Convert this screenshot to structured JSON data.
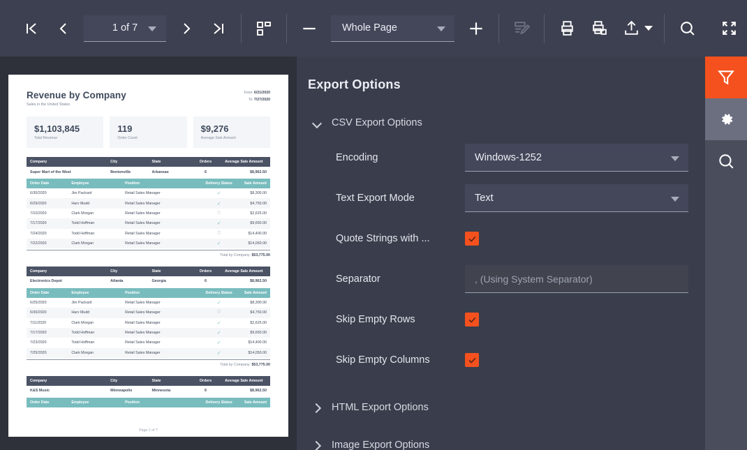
{
  "toolbar": {
    "first_page_label": "first-page",
    "prev_page_label": "previous-page",
    "page_indicator": "1 of 7",
    "next_page_label": "next-page",
    "last_page_label": "last-page",
    "page_layout_label": "page-layout",
    "zoom_out_label": "zoom-out",
    "zoom_level": "Whole Page",
    "zoom_in_label": "zoom-in",
    "edit_label": "edit-document",
    "print_label": "print",
    "print_copies_label": "print-multiple",
    "export_label": "export",
    "export_caret_label": "export-menu",
    "search_label": "search",
    "fullscreen_label": "fullscreen"
  },
  "export_panel": {
    "title": "Export Options",
    "sections": [
      {
        "label": "CSV Export Options",
        "expanded": true
      },
      {
        "label": "HTML Export Options",
        "expanded": false
      },
      {
        "label": "Image Export Options",
        "expanded": false
      }
    ],
    "csv_options": {
      "encoding": {
        "label": "Encoding",
        "value": "Windows-1252",
        "type": "select"
      },
      "text_export_mode": {
        "label": "Text Export Mode",
        "value": "Text",
        "type": "select"
      },
      "quote_strings": {
        "label": "Quote Strings with ...",
        "checked": true,
        "type": "checkbox"
      },
      "separator": {
        "label": "Separator",
        "value": "",
        "placeholder": ", (Using System Separator)",
        "type": "text"
      },
      "skip_empty_rows": {
        "label": "Skip Empty Rows",
        "checked": true,
        "type": "checkbox"
      },
      "skip_empty_columns": {
        "label": "Skip Empty Columns",
        "checked": true,
        "type": "checkbox"
      }
    }
  },
  "rail": {
    "filter_label": "filter-panel",
    "settings_label": "settings-panel",
    "search_label": "search-panel"
  },
  "report": {
    "title": "Revenue by Company",
    "subtitle": "Sales in the United States",
    "from_label": "From:",
    "from_value": "6/21/2020",
    "to_label": "To:",
    "to_value": "7/27/2020",
    "kpis": [
      {
        "value": "$1,103,845",
        "label": "Total Revenue"
      },
      {
        "value": "119",
        "label": "Order Count"
      },
      {
        "value": "$9,276",
        "label": "Average Sale Amount"
      }
    ],
    "company_headers": [
      "Company",
      "City",
      "State",
      "Orders",
      "Average Sale Amount"
    ],
    "detail_headers": [
      "Order Date",
      "Employee",
      "Position",
      "Delivery Status",
      "Sale Amount"
    ],
    "total_label": "Total by Company:",
    "footer": "Page 1 of 7",
    "groups": [
      {
        "company": [
          "Super Mart of the West",
          "Bentonville",
          "Arkansas",
          "6",
          "$8,962.50"
        ],
        "rows": [
          [
            "6/30/2020",
            "Jim Packard",
            "Retail Sales Manager",
            "check",
            "$8,300.00"
          ],
          [
            "6/29/2020",
            "Harv Mudd",
            "Retail Sales Manager",
            "check",
            "$4,750.00"
          ],
          [
            "7/10/2020",
            "Clark Morgan",
            "Retail Sales Manager",
            "truck",
            "$2,625.00"
          ],
          [
            "7/17/2020",
            "Todd Hoffman",
            "Retail Sales Manager",
            "check",
            "$9,650.00"
          ],
          [
            "7/24/2020",
            "Todd Hoffman",
            "Retail Sales Manager",
            "clock",
            "$14,400.00"
          ],
          [
            "7/22/2020",
            "Clark Morgan",
            "Retail Sales Manager",
            "check",
            "$14,050.00"
          ]
        ],
        "total": "$53,775.00"
      },
      {
        "company": [
          "Electronics Depot",
          "Atlanta",
          "Georgia",
          "6",
          "$8,962.50"
        ],
        "rows": [
          [
            "6/25/2020",
            "Jim Packard",
            "Retail Sales Manager",
            "check",
            "$8,300.00"
          ],
          [
            "6/30/2020",
            "Harv Mudd",
            "Retail Sales Manager",
            "clock",
            "$4,750.00"
          ],
          [
            "7/11/2020",
            "Clark Morgan",
            "Retail Sales Manager",
            "check",
            "$2,625.00"
          ],
          [
            "7/17/2020",
            "Todd Hoffman",
            "Retail Sales Manager",
            "check",
            "$9,650.00"
          ],
          [
            "7/23/2020",
            "Todd Hoffman",
            "Retail Sales Manager",
            "check",
            "$14,400.00"
          ],
          [
            "7/25/2020",
            "Clark Morgan",
            "Retail Sales Manager",
            "check",
            "$14,050.00"
          ]
        ],
        "total": "$53,775.00"
      },
      {
        "company": [
          "K&S Music",
          "Minneapolis",
          "Minnesota",
          "6",
          "$8,962.50"
        ],
        "rows": [],
        "total": ""
      }
    ]
  },
  "colors": {
    "toolbar_bg": "#3d4050",
    "doc_bg": "#2e303a",
    "panel_bg": "#3a3d4b",
    "accent": "#f4511e",
    "rail_bg": "#4a4d5c",
    "field_bg": "#44475a",
    "table_header_dark": "#4a5264",
    "table_header_teal": "#79bcbe"
  }
}
